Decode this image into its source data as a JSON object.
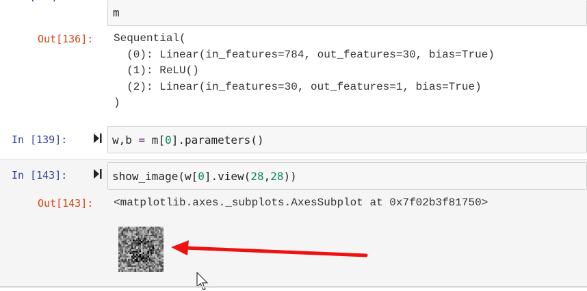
{
  "cells": {
    "partial_prompt": "[   ]",
    "cell_m": {
      "code": "m"
    },
    "out136": {
      "prompt": "Out[136]:",
      "lines": [
        "Sequential(",
        "  (0): Linear(in_features=784, out_features=30, bias=True)",
        "  (1): ReLU()",
        "  (2): Linear(in_features=30, out_features=1, bias=True)",
        ")"
      ]
    },
    "in139": {
      "prompt": "In [139]:",
      "code_a": "w,b ",
      "code_op": "=",
      "code_b": " m[",
      "code_num": "0",
      "code_c": "].parameters()"
    },
    "in143": {
      "prompt": "In [143]:",
      "code_a": "show_image(w[",
      "code_num1": "0",
      "code_b": "].view(",
      "code_num2": "28",
      "code_c": ",",
      "code_num3": "28",
      "code_d": "))"
    },
    "out143": {
      "prompt": "Out[143]:",
      "text": "<matplotlib.axes._subplots.AxesSubplot at 0x7f02b3f81750>"
    }
  },
  "colors": {
    "in_prompt": "#303f9f",
    "out_prompt": "#d84315",
    "number": "#098658",
    "arrow": "#ee1111"
  },
  "icons": [
    "run-cell-icon",
    "mouse-cursor-icon"
  ]
}
